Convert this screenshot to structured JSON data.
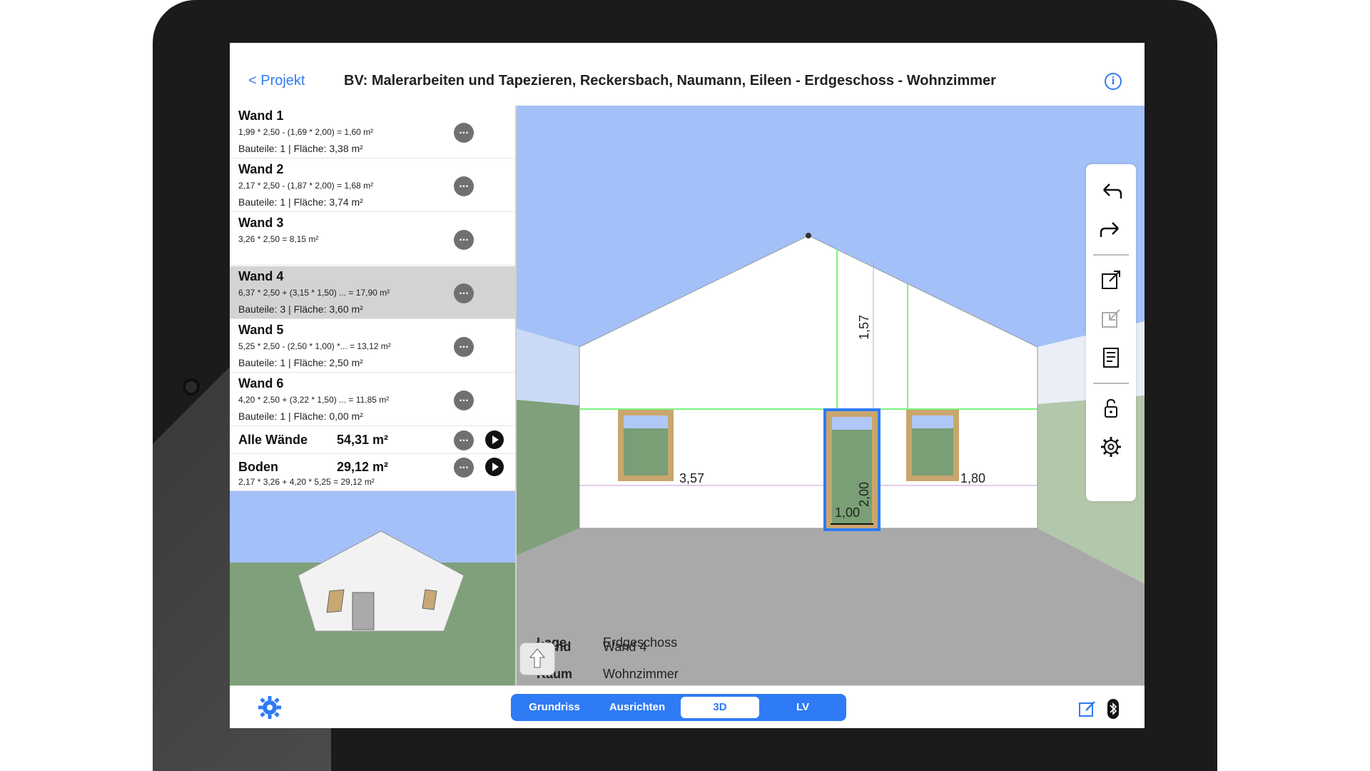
{
  "header": {
    "back_label": "< Projekt",
    "title": "BV: Malerarbeiten und Tapezieren, Reckersbach, Naumann, Eileen - Erdgeschoss - Wohnzimmer",
    "info_icon": "info-icon"
  },
  "walls": [
    {
      "name": "Wand 1",
      "calc": "1,99 * 2,50  - (1,69 * 2,00)   = 1,60 m²",
      "parts": "Bauteile: 1 | Fläche: 3,38 m²"
    },
    {
      "name": "Wand 2",
      "calc": "2,17 * 2,50  - (1,87 * 2,00)   = 1,68 m²",
      "parts": "Bauteile: 1 | Fläche: 3,74 m²"
    },
    {
      "name": "Wand 3",
      "calc": "3,26 * 2,50   = 8,15 m²",
      "parts": ""
    },
    {
      "name": "Wand 4",
      "calc": "6,37 * 2,50  + (3,15 * 1,50) ... = 17,90 m²",
      "parts": "Bauteile: 3 | Fläche: 3,60 m²"
    },
    {
      "name": "Wand 5",
      "calc": "5,25 * 2,50  - (2,50 * 1,00) *... = 13,12 m²",
      "parts": "Bauteile: 1 | Fläche: 2,50 m²"
    },
    {
      "name": "Wand 6",
      "calc": "4,20 * 2,50  + (3,22 * 1,50) ... = 11,85 m²",
      "parts": "Bauteile: 1 | Fläche: 0,00 m²"
    }
  ],
  "summary": {
    "all_walls_label": "Alle Wände",
    "all_walls_value": "54,31 m²",
    "floor_label": "Boden",
    "floor_value": "29,12 m²",
    "floor_calc": "2,17 * 3,26  + 4,20 * 5,25  = 29,12 m²"
  },
  "scene": {
    "dim_height": "1,57",
    "dim_left": "3,57",
    "dim_right": "1,80",
    "dim_door_height": "2,00",
    "dim_door_width": "1,00"
  },
  "info_panel": {
    "lage_label": "Lage",
    "lage_value": "Erdgeschoss",
    "raum_label": "Raum",
    "raum_value": "Wohnzimmer",
    "wand_label": "Wand",
    "wand_value": "Wand 4"
  },
  "toolbar": [
    "undo-icon",
    "redo-icon",
    "export-icon",
    "import-icon",
    "notes-icon",
    "lock-icon",
    "gear-icon"
  ],
  "bottom": {
    "tabs": [
      "Grundriss",
      "Ausrichten",
      "3D",
      "LV"
    ],
    "active_tab": "3D"
  },
  "colors": {
    "accent": "#2f7bf5",
    "sky": "#a3c0f8",
    "grass": "#7fa07a",
    "floor": "#a9a9a9"
  }
}
